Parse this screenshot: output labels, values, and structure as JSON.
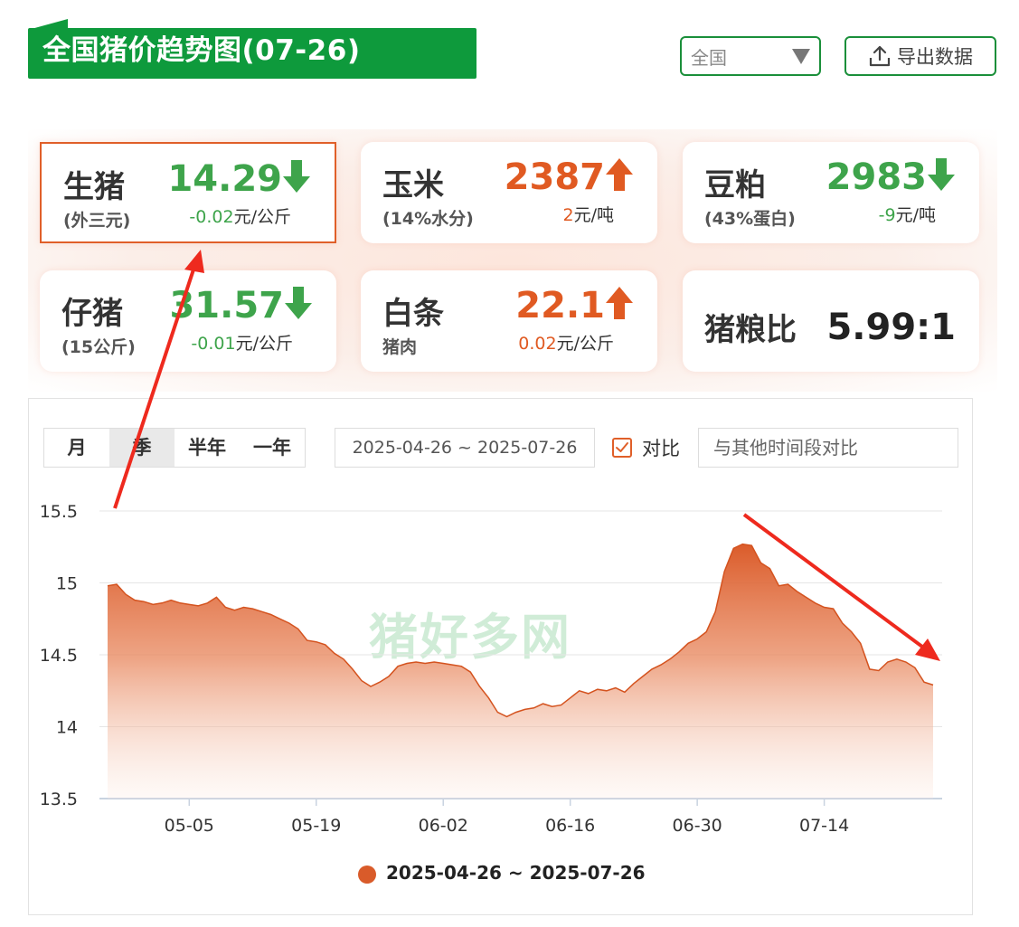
{
  "header": {
    "title": "全国猪价趋势图(07-26)",
    "region_selected": "全国",
    "export_label": "导出数据"
  },
  "cards": [
    {
      "name": "生猪",
      "sub": "(外三元)",
      "price": "14.29",
      "direction": "down",
      "change": "-0.02",
      "unit": "元/公斤",
      "selected": true
    },
    {
      "name": "玉米",
      "sub": "(14%水分)",
      "price": "2387",
      "direction": "up",
      "change": "2",
      "unit": "元/吨"
    },
    {
      "name": "豆粕",
      "sub": "(43%蛋白)",
      "price": "2983",
      "direction": "down",
      "change": "-9",
      "unit": "元/吨"
    },
    {
      "name": "仔猪",
      "sub": "(15公斤)",
      "price": "31.57",
      "direction": "down",
      "change": "-0.01",
      "unit": "元/公斤"
    },
    {
      "name": "白条",
      "sub": "猪肉",
      "price": "22.1",
      "direction": "up",
      "change": "0.02",
      "unit": "元/公斤"
    },
    {
      "name": "猪粮比",
      "ratio": "5.99:1"
    }
  ],
  "controls": {
    "range_tabs": [
      "月",
      "季",
      "半年",
      "一年"
    ],
    "active_tab": "季",
    "date_range": "2025-04-26 ~ 2025-07-26",
    "compare_label": "对比",
    "compare_placeholder": "与其他时间段对比"
  },
  "watermark": "猪好多网",
  "colors": {
    "brand_green": "#0e9a3c",
    "accent_orange": "#e05f29",
    "down_green": "#3ea44b",
    "up_orange": "#e05a22"
  },
  "chart_data": {
    "type": "area",
    "series": [
      {
        "name": "2025-04-26 ~ 2025-07-26"
      }
    ],
    "ylim": [
      13.5,
      15.5
    ],
    "yticks": [
      "15.5",
      "15",
      "14.5",
      "14",
      "13.5"
    ],
    "xtick_labels": [
      {
        "label": "05-05",
        "day": 9
      },
      {
        "label": "05-19",
        "day": 23
      },
      {
        "label": "06-02",
        "day": 37
      },
      {
        "label": "06-16",
        "day": 51
      },
      {
        "label": "06-30",
        "day": 65
      },
      {
        "label": "07-14",
        "day": 79
      }
    ],
    "x": [
      "04-26",
      "04-27",
      "04-28",
      "04-29",
      "04-30",
      "05-01",
      "05-02",
      "05-03",
      "05-04",
      "05-05",
      "05-06",
      "05-07",
      "05-08",
      "05-09",
      "05-10",
      "05-11",
      "05-12",
      "05-13",
      "05-14",
      "05-15",
      "05-16",
      "05-17",
      "05-18",
      "05-19",
      "05-20",
      "05-21",
      "05-22",
      "05-23",
      "05-24",
      "05-25",
      "05-26",
      "05-27",
      "05-28",
      "05-29",
      "05-30",
      "05-31",
      "06-01",
      "06-02",
      "06-03",
      "06-04",
      "06-05",
      "06-06",
      "06-07",
      "06-08",
      "06-09",
      "06-10",
      "06-11",
      "06-12",
      "06-13",
      "06-14",
      "06-15",
      "06-16",
      "06-17",
      "06-18",
      "06-19",
      "06-20",
      "06-21",
      "06-22",
      "06-23",
      "06-24",
      "06-25",
      "06-26",
      "06-27",
      "06-28",
      "06-29",
      "06-30",
      "07-01",
      "07-02",
      "07-03",
      "07-04",
      "07-05",
      "07-06",
      "07-07",
      "07-08",
      "07-09",
      "07-10",
      "07-11",
      "07-12",
      "07-13",
      "07-14",
      "07-15",
      "07-16",
      "07-17",
      "07-18",
      "07-19",
      "07-20",
      "07-21",
      "07-22",
      "07-23",
      "07-24",
      "07-25",
      "07-26"
    ],
    "values": [
      14.98,
      14.99,
      14.92,
      14.88,
      14.87,
      14.85,
      14.86,
      14.88,
      14.86,
      14.85,
      14.84,
      14.86,
      14.9,
      14.83,
      14.81,
      14.83,
      14.82,
      14.8,
      14.78,
      14.75,
      14.72,
      14.68,
      14.6,
      14.59,
      14.57,
      14.51,
      14.47,
      14.4,
      14.32,
      14.28,
      14.31,
      14.35,
      14.42,
      14.44,
      14.45,
      14.44,
      14.45,
      14.44,
      14.43,
      14.42,
      14.38,
      14.28,
      14.2,
      14.1,
      14.07,
      14.1,
      14.12,
      14.13,
      14.16,
      14.14,
      14.15,
      14.2,
      14.25,
      14.23,
      14.26,
      14.25,
      14.27,
      14.24,
      14.3,
      14.35,
      14.4,
      14.43,
      14.47,
      14.52,
      14.58,
      14.61,
      14.66,
      14.8,
      15.08,
      15.24,
      15.27,
      15.26,
      15.14,
      15.1,
      14.98,
      14.99,
      14.94,
      14.9,
      14.86,
      14.83,
      14.82,
      14.72,
      14.66,
      14.58,
      14.4,
      14.39,
      14.45,
      14.47,
      14.45,
      14.41,
      14.31,
      14.29
    ]
  }
}
